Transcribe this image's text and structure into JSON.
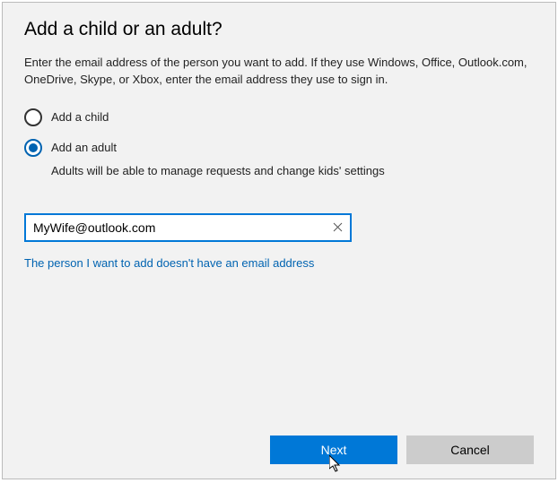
{
  "title": "Add a child or an adult?",
  "description": "Enter the email address of the person you want to add. If they use Windows, Office, Outlook.com, OneDrive, Skype, or Xbox, enter the email address they use to sign in.",
  "radios": {
    "child": {
      "label": "Add a child"
    },
    "adult": {
      "label": "Add an adult",
      "helper": "Adults will be able to manage requests and change kids' settings"
    }
  },
  "email": {
    "value": "MyWife@outlook.com"
  },
  "link_no_email": "The person I want to add doesn't have an email address",
  "buttons": {
    "next": "Next",
    "cancel": "Cancel"
  }
}
